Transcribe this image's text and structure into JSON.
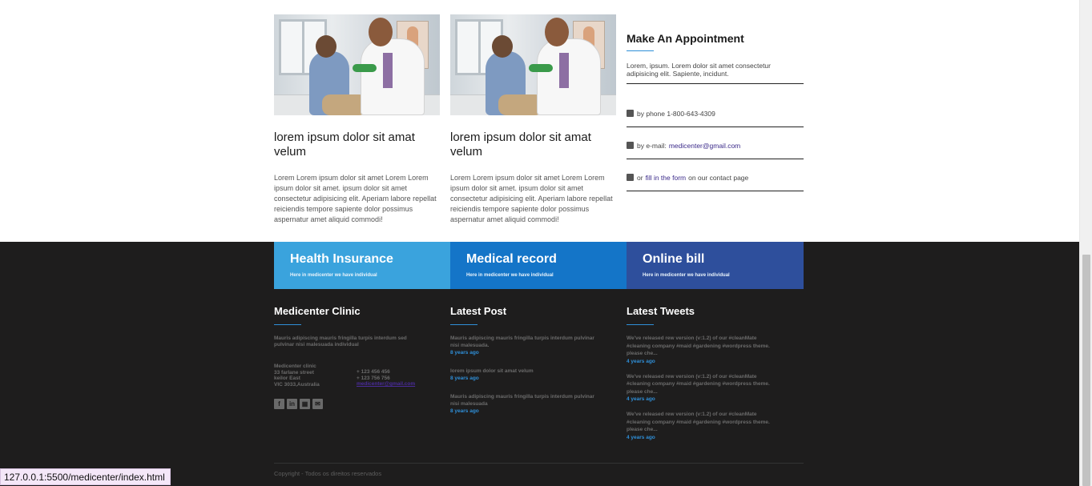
{
  "cards": [
    {
      "title": "lorem ipsum dolor sit amat velum",
      "text": "Lorem Lorem ipsum dolor sit amet Lorem Lorem ipsum dolor sit amet. ipsum dolor sit amet consectetur adipisicing elit. Aperiam labore repellat reiciendis tempore sapiente dolor possimus aspernatur amet aliquid commodi!"
    },
    {
      "title": "lorem ipsum dolor sit amat velum",
      "text": "Lorem Lorem ipsum dolor sit amet Lorem Lorem ipsum dolor sit amet. ipsum dolor sit amet consectetur adipisicing elit. Aperiam labore repellat reiciendis tempore sapiente dolor possimus aspernatur amet aliquid commodi!"
    }
  ],
  "appointment": {
    "title": "Make An Appointment",
    "description": "Lorem, ipsum. Lorem dolor sit amet consectetur adipisicing elit. Sapiente, incidunt.",
    "phone_text": "by phone 1-800-643-4309",
    "email_prefix": "by e-mail:",
    "email": "medicenter@gmail.com",
    "form_prefix": "or",
    "form_link": "fill in the form",
    "form_suffix": "on our contact page"
  },
  "banners": [
    {
      "title": "Health Insurance",
      "subtitle": "Here in medicenter we have individual",
      "color": "#3aa3dd"
    },
    {
      "title": "Medical record",
      "subtitle": "Here in medicenter we have individual",
      "color": "#1475c8"
    },
    {
      "title": "Online bill",
      "subtitle": "Here in medicenter we have individual",
      "color": "#2e4f9c"
    }
  ],
  "footer": {
    "clinic": {
      "title": "Medicenter Clinic",
      "description": "Mauris adipiscing mauris fringilla turpis interdum sed pulvinar nisi malesuada individual",
      "address": [
        "Medicenter clinic",
        "33 farlane street",
        "keilor East",
        "VIC 3033,Australia"
      ],
      "phones": [
        "+ 123 456 456",
        "+ 123 756 756"
      ],
      "email": "medicenter@gmail.com",
      "socials": [
        "facebook-icon",
        "linkedin-icon",
        "calendar-icon",
        "mail-icon"
      ]
    },
    "latest_post": {
      "title": "Latest Post",
      "posts": [
        {
          "text": "Mauris adipiscing mauris fringilla turpis interdum pulvinar nisi malesuada.",
          "date": "8 years ago"
        },
        {
          "text": "lorem ipsum dolor sit amat velum",
          "date": "8 years ago"
        },
        {
          "text": "Mauris adipiscing mauris fringilla turpis interdum pulvinar nisi malesuada",
          "date": "8 years ago"
        }
      ]
    },
    "latest_tweets": {
      "title": "Latest Tweets",
      "tweets": [
        {
          "text": "We've released rew version (v:1.2) of our #cleanMate #cleaning company #maid #gardening #wordpress theme. please che...",
          "date": "4 years ago"
        },
        {
          "text": "We've released rew version (v:1.2) of our #cleanMate #cleaning company #maid #gardening #wordpress theme. please che...",
          "date": "4 years ago"
        },
        {
          "text": "We've released rew version (v:1.2) of our #cleanMate #cleaning company #maid #gardening #wordpress theme. please che...",
          "date": "4 years ago"
        }
      ]
    },
    "copyright": "Copyright - Todos os direitos reservados"
  },
  "status_bar": {
    "url": "127.0.0.1:5500/medicenter/index.html"
  },
  "colors": {
    "accent": "#2f8fd8",
    "footer_bg": "#1e1d1d",
    "link": "#3b2a8a"
  }
}
